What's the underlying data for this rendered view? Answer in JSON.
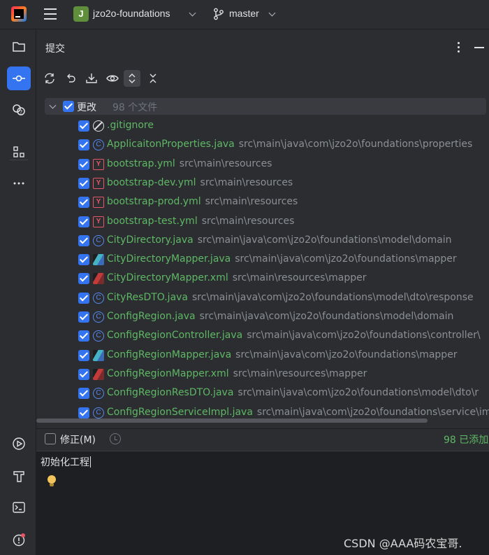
{
  "header": {
    "project_initial": "J",
    "project_name": "jzo2o-foundations",
    "branch": "master"
  },
  "toolstrip": {
    "items": [
      "folder-icon",
      "commit-icon",
      "pull-requests-icon",
      "structure-icon",
      "more-icon",
      "run-icon",
      "build-icon",
      "terminal-icon",
      "problems-icon"
    ],
    "active": "commit-icon",
    "accent": "#3574f0"
  },
  "panel": {
    "title": "提交"
  },
  "changes": {
    "group_label": "更改",
    "group_count": "98 个文件",
    "files": [
      {
        "name": ".gitignore",
        "path": "",
        "icon": "ignore"
      },
      {
        "name": "ApplicaitonProperties.java",
        "path": "src\\main\\java\\com\\jzo2o\\foundations\\properties",
        "icon": "class"
      },
      {
        "name": "bootstrap.yml",
        "path": "src\\main\\resources",
        "icon": "yml"
      },
      {
        "name": "bootstrap-dev.yml",
        "path": "src\\main\\resources",
        "icon": "yml"
      },
      {
        "name": "bootstrap-prod.yml",
        "path": "src\\main\\resources",
        "icon": "yml"
      },
      {
        "name": "bootstrap-test.yml",
        "path": "src\\main\\resources",
        "icon": "yml"
      },
      {
        "name": "CityDirectory.java",
        "path": "src\\main\\java\\com\\jzo2o\\foundations\\model\\domain",
        "icon": "class"
      },
      {
        "name": "CityDirectoryMapper.java",
        "path": "src\\main\\java\\com\\jzo2o\\foundations\\mapper",
        "icon": "mapper-java"
      },
      {
        "name": "CityDirectoryMapper.xml",
        "path": "src\\main\\resources\\mapper",
        "icon": "mapper-xml"
      },
      {
        "name": "CityResDTO.java",
        "path": "src\\main\\java\\com\\jzo2o\\foundations\\model\\dto\\response",
        "icon": "class"
      },
      {
        "name": "ConfigRegion.java",
        "path": "src\\main\\java\\com\\jzo2o\\foundations\\model\\domain",
        "icon": "class"
      },
      {
        "name": "ConfigRegionController.java",
        "path": "src\\main\\java\\com\\jzo2o\\foundations\\controller\\",
        "icon": "class"
      },
      {
        "name": "ConfigRegionMapper.java",
        "path": "src\\main\\java\\com\\jzo2o\\foundations\\mapper",
        "icon": "mapper-java"
      },
      {
        "name": "ConfigRegionMapper.xml",
        "path": "src\\main\\resources\\mapper",
        "icon": "mapper-xml"
      },
      {
        "name": "ConfigRegionResDTO.java",
        "path": "src\\main\\java\\com\\jzo2o\\foundations\\model\\dto\\r",
        "icon": "class"
      },
      {
        "name": "ConfigRegionServiceImpl.java",
        "path": "src\\main\\java\\com\\jzo2o\\foundations\\service\\im",
        "icon": "class"
      }
    ],
    "file_name_color": "#5fb865"
  },
  "commit": {
    "amend_label": "修正(M)",
    "added_count": "98 已添加",
    "message": "初始化工程"
  },
  "watermark": "CSDN @AAA码农宝哥."
}
